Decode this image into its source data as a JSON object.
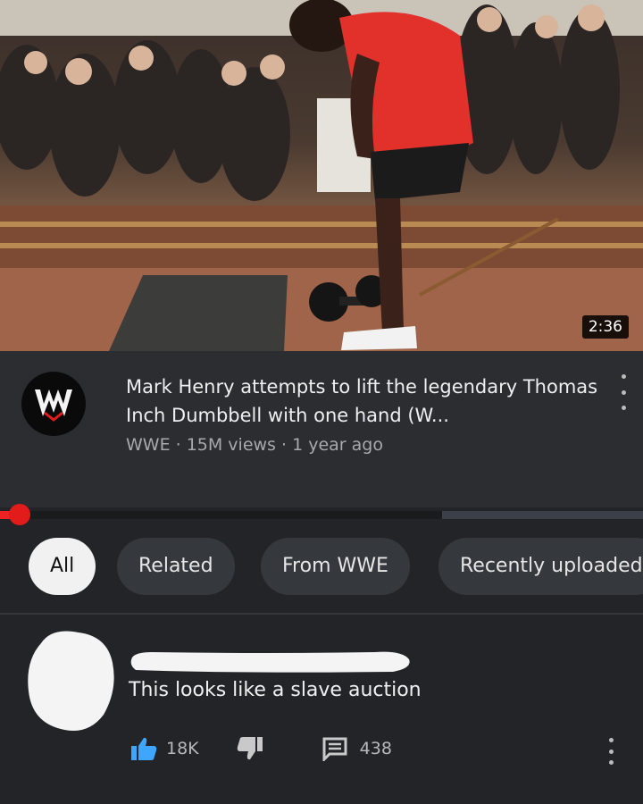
{
  "video": {
    "duration": "2:36",
    "title": "Mark Henry attempts to lift the legendary Thomas Inch Dumbbell with one hand (W...",
    "meta": "WWE · 15M views · 1 year ago",
    "channel_logo": "W",
    "progress_fraction": 0.03
  },
  "chips": {
    "items": [
      "All",
      "Related",
      "From WWE",
      "Recently uploaded"
    ],
    "active_index": 0
  },
  "comment": {
    "text": "This looks like a slave auction",
    "likes": "18K",
    "replies": "438"
  },
  "icons": {
    "channel": "wwe-logo-icon",
    "more": "more-vertical-icon",
    "like": "thumbs-up-icon",
    "dislike": "thumbs-down-icon",
    "reply": "comment-icon"
  },
  "colors": {
    "accent_red": "#e21b1b",
    "like_blue": "#3ea6ff",
    "background": "#222427"
  }
}
